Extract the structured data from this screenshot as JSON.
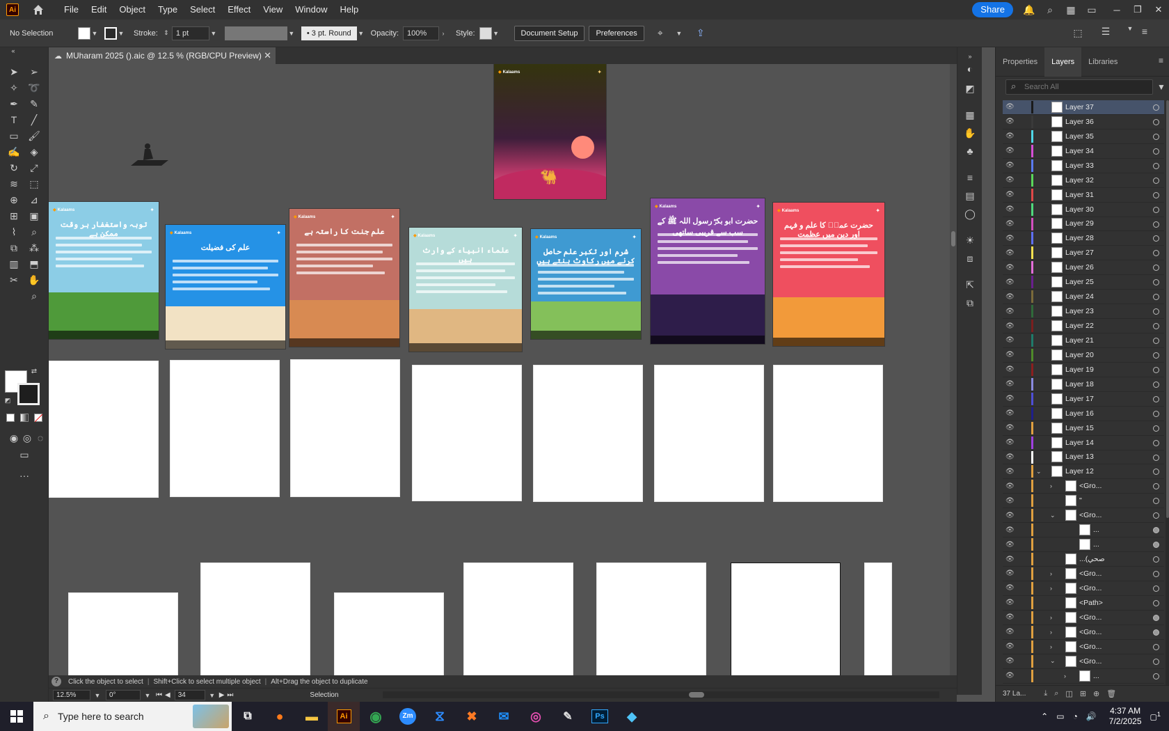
{
  "menu": {
    "items": [
      "File",
      "Edit",
      "Object",
      "Type",
      "Select",
      "Effect",
      "View",
      "Window",
      "Help"
    ],
    "share_label": "Share",
    "app_badge": "Ai"
  },
  "control": {
    "selection": "No Selection",
    "stroke_label": "Stroke:",
    "stroke_value": "1 pt",
    "brush_style": "3 pt. Round",
    "opacity_label": "Opacity:",
    "opacity_value": "100%",
    "style_label": "Style:",
    "doc_setup": "Document Setup",
    "preferences": "Preferences"
  },
  "document": {
    "tab_title": "MUharam 2025 ().aic @ 12.5 % (RGB/CPU Preview)"
  },
  "cards": [
    {
      "brand": "Kalaams",
      "title": "توبہ واستغفار ہر وقت ممکن ہے",
      "bg": "#8ccde6",
      "ground": "#4f9a3a"
    },
    {
      "brand": "Kalaams",
      "title": "علم کی فضیلت",
      "bg": "#2592e6",
      "ground": "#f2e2c4"
    },
    {
      "brand": "Kalaams",
      "title": "علم جنت کا راستہ ہے",
      "bg": "#c27064",
      "ground": "#d88a52"
    },
    {
      "brand": "Kalaams",
      "title": "علماء انبیاء کے وارث ہیں",
      "bg": "#b6dcd9",
      "ground": "#e0b782"
    },
    {
      "brand": "Kalaams",
      "title": "شرم اور تکبر علم حاصل کرنے میں رکاوٹ بنتے ہیں",
      "bg": "#3f9ad2",
      "ground": "#84c05a"
    },
    {
      "brand": "Kalaams",
      "title": "حضرت ابو بکرؓ رسول اللہ ﷺ کے سب سے قریبی ساتھی",
      "bg": "#8a4aa8",
      "ground": "#2e1d4a"
    },
    {
      "brand": "Kalaams",
      "title": "حضرت عمرؓ کا علم و فہم اور دین میں عظمت",
      "bg": "#ef4f5f",
      "ground": "#f29a3a"
    }
  ],
  "hero_card": {
    "brand": "Kalaams"
  },
  "panel": {
    "tabs": [
      "Properties",
      "Layers",
      "Libraries"
    ],
    "active_tab": "Layers",
    "search_placeholder": "Search All",
    "layer_count": "37 La..."
  },
  "layers": [
    {
      "name": "Layer 37",
      "color": "#1a1a1a",
      "selected": true
    },
    {
      "name": "Layer 36",
      "color": "#3a3a3a"
    },
    {
      "name": "Layer 35",
      "color": "#4fd7e8"
    },
    {
      "name": "Layer 34",
      "color": "#d64fd6"
    },
    {
      "name": "Layer 33",
      "color": "#5a7af0"
    },
    {
      "name": "Layer 32",
      "color": "#5ad65a"
    },
    {
      "name": "Layer 31",
      "color": "#e04848"
    },
    {
      "name": "Layer 30",
      "color": "#4fd77c"
    },
    {
      "name": "Layer 29",
      "color": "#d44fbf"
    },
    {
      "name": "Layer 28",
      "color": "#5f6ff5"
    },
    {
      "name": "Layer 27",
      "color": "#f5e14f"
    },
    {
      "name": "Layer 26",
      "color": "#e36dd9"
    },
    {
      "name": "Layer 25",
      "color": "#6a1f8e"
    },
    {
      "name": "Layer 24",
      "color": "#7a6a3a"
    },
    {
      "name": "Layer 23",
      "color": "#2f6a3a"
    },
    {
      "name": "Layer 22",
      "color": "#7a1f1f"
    },
    {
      "name": "Layer 21",
      "color": "#1f7a6a"
    },
    {
      "name": "Layer 20",
      "color": "#4f8a2a"
    },
    {
      "name": "Layer 19",
      "color": "#8a1f1f"
    },
    {
      "name": "Layer 18",
      "color": "#8a8ae0"
    },
    {
      "name": "Layer 17",
      "color": "#4f4fd6"
    },
    {
      "name": "Layer 16",
      "color": "#1f1f8a"
    },
    {
      "name": "Layer 15",
      "color": "#e0a040"
    },
    {
      "name": "Layer 14",
      "color": "#a040e0"
    },
    {
      "name": "Layer 13",
      "color": "#ffffff"
    },
    {
      "name": "Layer 12",
      "color": "#e0a040",
      "expanded": true
    },
    {
      "name": "<Gro...",
      "color": "#e0a040",
      "depth": 1,
      "chev": "›"
    },
    {
      "name": "\"",
      "color": "#e0a040",
      "depth": 1
    },
    {
      "name": "<Gro...",
      "color": "#e0a040",
      "depth": 1,
      "chev": "⌄"
    },
    {
      "name": "...",
      "color": "#e0a040",
      "depth": 2,
      "filled": true
    },
    {
      "name": "...",
      "color": "#e0a040",
      "depth": 2,
      "filled": true
    },
    {
      "name": "...(صحي",
      "color": "#e0a040",
      "depth": 1
    },
    {
      "name": "<Gro...",
      "color": "#e0a040",
      "depth": 1,
      "chev": "›"
    },
    {
      "name": "<Gro...",
      "color": "#e0a040",
      "depth": 1,
      "chev": "›"
    },
    {
      "name": "<Path>",
      "color": "#e0a040",
      "depth": 1
    },
    {
      "name": "<Gro...",
      "color": "#e0a040",
      "depth": 1,
      "chev": "›",
      "filled": true
    },
    {
      "name": "<Gro...",
      "color": "#e0a040",
      "depth": 1,
      "chev": "›",
      "filled": true
    },
    {
      "name": "<Gro...",
      "color": "#e0a040",
      "depth": 1,
      "chev": "›"
    },
    {
      "name": "<Gro...",
      "color": "#e0a040",
      "depth": 1,
      "chev": "⌄"
    },
    {
      "name": "...",
      "color": "#e0a040",
      "depth": 2,
      "chev": "›"
    }
  ],
  "hint": {
    "text1": "Click the object to select",
    "text2": "Shift+Click to select multiple object",
    "text3": "Alt+Drag the object to duplicate"
  },
  "status": {
    "zoom": "12.5%",
    "rotation": "0°",
    "artboard": "34",
    "mode": "Selection"
  },
  "taskbar": {
    "search_placeholder": "Type here to search",
    "time": "4:37 AM",
    "date": "7/2/2025",
    "notification_count": "1",
    "apps": [
      "Zm",
      "Ai",
      "Ps"
    ]
  }
}
